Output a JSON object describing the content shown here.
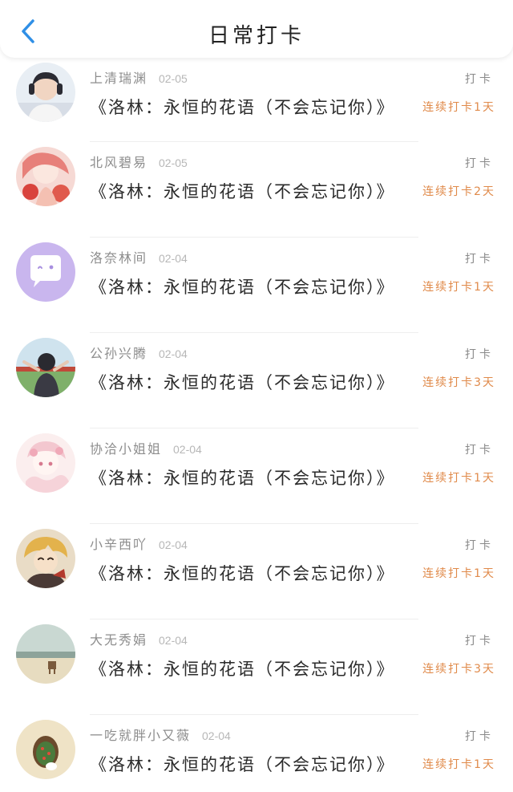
{
  "header": {
    "title": "日常打卡",
    "back_icon": "chevron-left-icon",
    "accent": "#2f8fe6"
  },
  "checkin_label": "打卡",
  "entries": [
    {
      "username": "上清瑞渊",
      "date": "02-05",
      "book": "《洛林：永恒的花语（不会忘记你）》",
      "streak": "连续打卡1天"
    },
    {
      "username": "北风碧易",
      "date": "02-05",
      "book": "《洛林：永恒的花语（不会忘记你）》",
      "streak": "连续打卡2天"
    },
    {
      "username": "洛奈林间",
      "date": "02-04",
      "book": "《洛林：永恒的花语（不会忘记你）》",
      "streak": "连续打卡1天"
    },
    {
      "username": "公孙兴腾",
      "date": "02-04",
      "book": "《洛林：永恒的花语（不会忘记你）》",
      "streak": "连续打卡3天"
    },
    {
      "username": "协洽小姐姐",
      "date": "02-04",
      "book": "《洛林：永恒的花语（不会忘记你）》",
      "streak": "连续打卡1天"
    },
    {
      "username": "小辛西吖",
      "date": "02-04",
      "book": "《洛林：永恒的花语（不会忘记你）》",
      "streak": "连续打卡1天"
    },
    {
      "username": "大无秀娟",
      "date": "02-04",
      "book": "《洛林：永恒的花语（不会忘记你）》",
      "streak": "连续打卡3天"
    },
    {
      "username": "一吃就胖小又薇",
      "date": "02-04",
      "book": "《洛林：永恒的花语（不会忘记你）》",
      "streak": "连续打卡1天"
    }
  ],
  "colors": {
    "streak": "#e08a4a",
    "username": "#8d8d8d",
    "date": "#b7b7b7"
  }
}
